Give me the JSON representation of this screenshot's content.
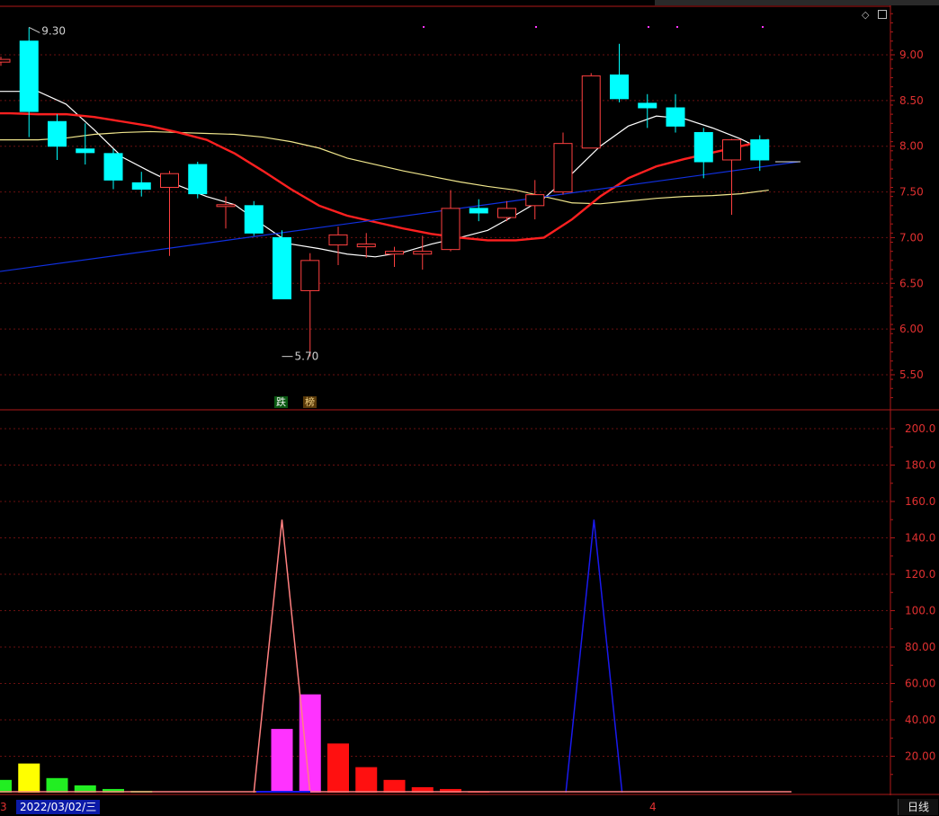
{
  "chart_data": [
    {
      "type": "candlestick",
      "price_axis": {
        "ticks": [
          "9.00",
          "8.50",
          "8.00",
          "7.50",
          "7.00",
          "6.50",
          "6.00",
          "5.50"
        ],
        "ylim": [
          5.15,
          9.55
        ],
        "grid": true
      },
      "annotations": {
        "high": {
          "label": "9.30",
          "value": 9.3,
          "bar_index": 1
        },
        "low": {
          "label": "5.70",
          "value": 5.7,
          "bar_index": 10
        }
      },
      "candles": [
        {
          "o": 8.92,
          "h": 8.98,
          "l": 8.88,
          "c": 8.95
        },
        {
          "o": 9.15,
          "h": 9.3,
          "l": 8.1,
          "c": 8.38
        },
        {
          "o": 8.27,
          "h": 8.35,
          "l": 7.85,
          "c": 8.0
        },
        {
          "o": 7.97,
          "h": 8.25,
          "l": 7.8,
          "c": 7.93
        },
        {
          "o": 7.92,
          "h": 7.97,
          "l": 7.53,
          "c": 7.63
        },
        {
          "o": 7.6,
          "h": 7.72,
          "l": 7.45,
          "c": 7.53
        },
        {
          "o": 7.55,
          "h": 7.73,
          "l": 6.8,
          "c": 7.7
        },
        {
          "o": 7.8,
          "h": 7.83,
          "l": 7.43,
          "c": 7.48
        },
        {
          "o": 7.36,
          "h": 7.45,
          "l": 7.1,
          "c": 7.36
        },
        {
          "o": 7.35,
          "h": 7.4,
          "l": 7.02,
          "c": 7.05
        },
        {
          "o": 7.0,
          "h": 7.08,
          "l": 6.33,
          "c": 6.33
        },
        {
          "o": 6.42,
          "h": 6.83,
          "l": 5.7,
          "c": 6.75
        },
        {
          "o": 6.92,
          "h": 7.12,
          "l": 6.7,
          "c": 7.03
        },
        {
          "o": 6.9,
          "h": 7.05,
          "l": 6.78,
          "c": 6.93
        },
        {
          "o": 6.82,
          "h": 6.9,
          "l": 6.68,
          "c": 6.85
        },
        {
          "o": 6.82,
          "h": 7.02,
          "l": 6.65,
          "c": 6.85
        },
        {
          "o": 6.87,
          "h": 7.52,
          "l": 6.85,
          "c": 7.32
        },
        {
          "o": 7.32,
          "h": 7.42,
          "l": 7.18,
          "c": 7.27
        },
        {
          "o": 7.22,
          "h": 7.4,
          "l": 7.18,
          "c": 7.32
        },
        {
          "o": 7.35,
          "h": 7.63,
          "l": 7.2,
          "c": 7.47
        },
        {
          "o": 7.5,
          "h": 8.15,
          "l": 7.47,
          "c": 8.03
        },
        {
          "o": 7.98,
          "h": 8.8,
          "l": 7.98,
          "c": 8.77
        },
        {
          "o": 8.78,
          "h": 9.12,
          "l": 8.48,
          "c": 8.52
        },
        {
          "o": 8.47,
          "h": 8.57,
          "l": 8.2,
          "c": 8.42
        },
        {
          "o": 8.42,
          "h": 8.57,
          "l": 8.15,
          "c": 8.22
        },
        {
          "o": 8.15,
          "h": 8.2,
          "l": 7.65,
          "c": 7.83
        },
        {
          "o": 7.85,
          "h": 8.08,
          "l": 7.25,
          "c": 8.07
        },
        {
          "o": 8.07,
          "h": 8.12,
          "l": 7.73,
          "c": 7.85
        }
      ],
      "lines": [
        {
          "color": "#ffffff",
          "values": [
            8.6,
            8.6,
            8.6,
            8.46,
            8.18,
            7.88,
            7.72,
            7.57,
            7.45,
            7.36,
            7.14,
            6.93,
            6.88,
            6.82,
            6.79,
            6.84,
            6.93,
            7.0,
            7.08,
            7.25,
            7.43,
            7.7,
            8.0,
            8.22,
            8.33,
            8.3,
            8.2,
            8.08,
            7.93
          ]
        },
        {
          "color": "#f0e68c",
          "values": [
            8.07,
            8.07,
            8.07,
            8.09,
            8.13,
            8.15,
            8.16,
            8.15,
            8.14,
            8.13,
            8.1,
            8.05,
            7.98,
            7.87,
            7.8,
            7.73,
            7.67,
            7.61,
            7.56,
            7.52,
            7.45,
            7.38,
            7.37,
            7.4,
            7.43,
            7.45,
            7.46,
            7.48,
            7.52
          ]
        },
        {
          "color": "#ff2020",
          "values": [
            8.36,
            8.36,
            8.35,
            8.35,
            8.32,
            8.27,
            8.22,
            8.15,
            8.07,
            7.92,
            7.73,
            7.53,
            7.35,
            7.24,
            7.17,
            7.1,
            7.04,
            7.0,
            6.97,
            6.97,
            7.0,
            7.2,
            7.45,
            7.65,
            7.78,
            7.86,
            7.93,
            8.0,
            8.07
          ]
        },
        {
          "color": "#1030e0",
          "values": [
            6.63,
            7.83
          ]
        }
      ]
    },
    {
      "type": "bar",
      "value_axis": {
        "ticks": [
          "200.0",
          "180.0",
          "160.0",
          "140.0",
          "120.0",
          "100.0",
          "80.00",
          "60.00",
          "40.00",
          "20.00"
        ],
        "ylim": [
          0,
          208
        ]
      },
      "bars": [
        {
          "value": 7,
          "color": "#22ee22"
        },
        {
          "value": 16,
          "color": "#ffff00"
        },
        {
          "value": 8,
          "color": "#22ee22"
        },
        {
          "value": 4,
          "color": "#22ee22"
        },
        {
          "value": 2,
          "color": "#22ee22"
        },
        {
          "value": 1,
          "color": "#22ee22"
        },
        {
          "value": 0,
          "color": "#22ee22"
        },
        {
          "value": 0,
          "color": "#22ee22"
        },
        {
          "value": 0,
          "color": "#22ee22"
        },
        {
          "value": 0,
          "color": "#22ee22"
        },
        {
          "value": 35,
          "color": "#ff33ff"
        },
        {
          "value": 54,
          "color": "#ff33ff"
        },
        {
          "value": 27,
          "color": "#ff1010"
        },
        {
          "value": 14,
          "color": "#ff1010"
        },
        {
          "value": 7,
          "color": "#ff1010"
        },
        {
          "value": 3,
          "color": "#ff1010"
        },
        {
          "value": 2,
          "color": "#ff1010"
        },
        {
          "value": 0.8,
          "color": "#ff1010"
        }
      ],
      "spikes": [
        {
          "color": "#ff8080",
          "points": [
            [
              9,
              0
            ],
            [
              10,
              150
            ],
            [
              11,
              0
            ]
          ]
        },
        {
          "color": "#1a1aee",
          "points": [
            [
              20.1,
              0
            ],
            [
              21.1,
              150
            ],
            [
              22.1,
              0
            ]
          ]
        }
      ]
    }
  ],
  "badges": {
    "down": "跌",
    "rank": "榜"
  },
  "footer": {
    "date": "2022/03/02/三",
    "left_num": "3",
    "month": "4"
  },
  "period": "日线",
  "colors": {
    "up": "#ff4040",
    "down": "#00ffff",
    "axis": "#b01818",
    "grid": "#6a1010"
  }
}
